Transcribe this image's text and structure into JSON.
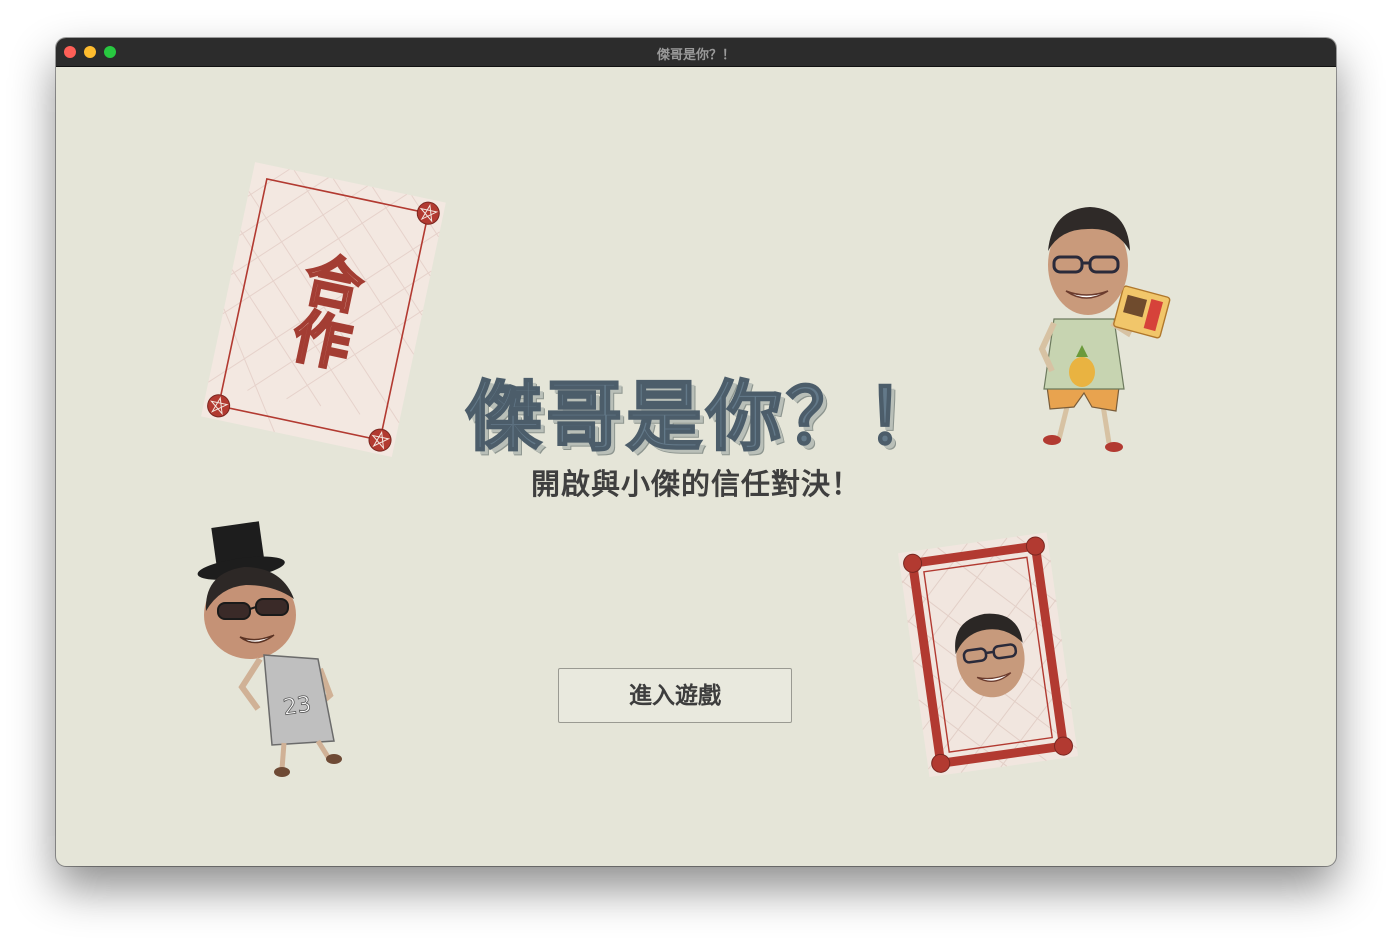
{
  "window": {
    "title": "傑哥是你？！"
  },
  "main": {
    "title": "傑哥是你？！",
    "subtitle": "開啟與小傑的信任對決！",
    "enter_button_label": "進入遊戲"
  },
  "cards": {
    "cooperate_card_text": "合作",
    "player_shirt_number": "23"
  },
  "colors": {
    "background": "#e5e5d8",
    "title_fill": "#637989",
    "card_red": "#b23a31"
  }
}
